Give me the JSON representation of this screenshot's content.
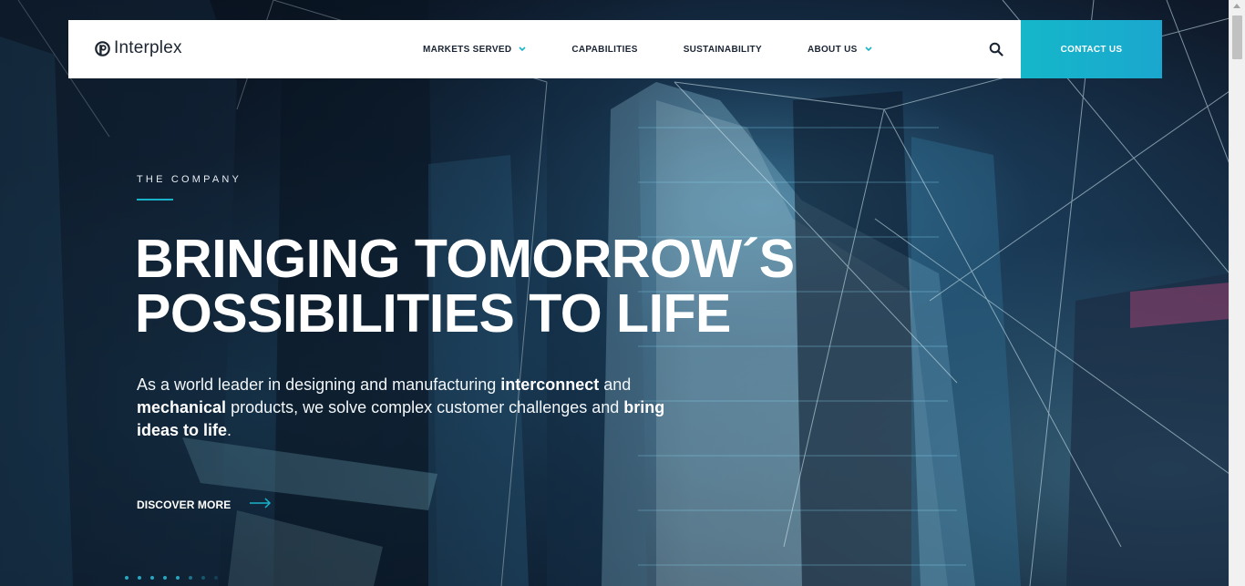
{
  "brand": {
    "name": "Interplex",
    "logo_icon": "interplex-logo-icon"
  },
  "nav": {
    "items": [
      {
        "label": "MARKETS SERVED",
        "has_dropdown": true
      },
      {
        "label": "CAPABILITIES",
        "has_dropdown": false
      },
      {
        "label": "SUSTAINABILITY",
        "has_dropdown": false
      },
      {
        "label": "ABOUT US",
        "has_dropdown": true
      }
    ],
    "search_icon": "search-icon",
    "contact_label": "CONTACT US"
  },
  "hero": {
    "eyebrow": "THE COMPANY",
    "headline_line1": "BRINGING TOMORROW´S",
    "headline_line2": "POSSIBILITIES TO LIFE",
    "intro": {
      "t1": "As a world leader in designing and manufacturing ",
      "b1": "interconnect",
      "t2": " and ",
      "b2": "mechanical",
      "t3": " products, we solve complex customer challenges and ",
      "b3": "bring ideas to life",
      "t4": "."
    },
    "cta_label": "DISCOVER MORE",
    "cta_icon": "arrow-right-icon"
  },
  "colors": {
    "accent": "#18b3c8",
    "contact_bg": "#15b7c9",
    "nav_text": "#1a2433",
    "hero_text": "#ffffff"
  }
}
